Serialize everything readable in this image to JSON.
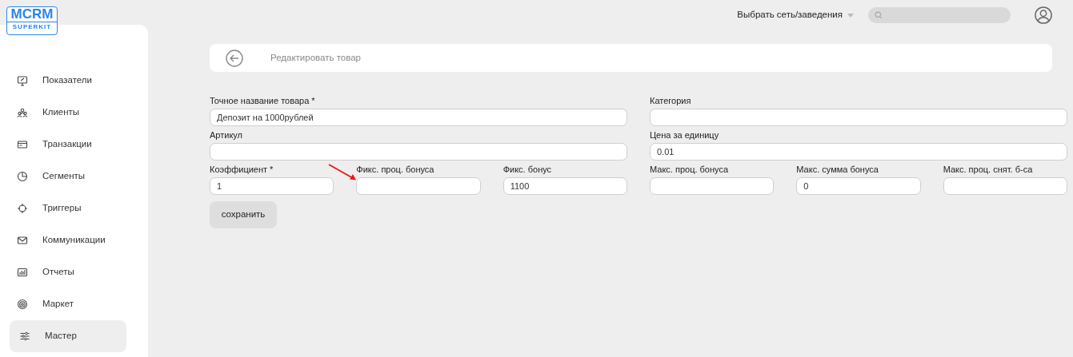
{
  "logo": {
    "title": "MCRM",
    "subtitle": "SUPERKIT"
  },
  "sidebar": {
    "items": [
      {
        "label": "Показатели",
        "selected": false
      },
      {
        "label": "Клиенты",
        "selected": false
      },
      {
        "label": "Транзакции",
        "selected": false
      },
      {
        "label": "Сегменты",
        "selected": false
      },
      {
        "label": "Триггеры",
        "selected": false
      },
      {
        "label": "Коммуникации",
        "selected": false
      },
      {
        "label": "Отчеты",
        "selected": false
      },
      {
        "label": "Маркет",
        "selected": false
      },
      {
        "label": "Мастер",
        "selected": true
      }
    ]
  },
  "topbar": {
    "network_select": "Выбрать сеть/заведения"
  },
  "header": {
    "title": "Редактировать товар"
  },
  "form": {
    "rows": [
      [
        {
          "label": "Точное название товара *",
          "value": "Депозит на 1000рублей"
        },
        {
          "label": "Категория"
        }
      ],
      [
        {
          "label": "Артикул"
        },
        {
          "label": "Цена за единицу",
          "value": "0.01"
        }
      ],
      [
        {
          "label": "Коэффициент *",
          "value": "1"
        },
        {
          "label": "Фикс. проц. бонуса"
        },
        {
          "label": "Фикс. бонус",
          "value": "1100"
        },
        {
          "label": "Макс. проц. бонуса"
        },
        {
          "label": "Макс. сумма бонуса",
          "value": "0"
        },
        {
          "label": "Макс. проц. снят. б-са"
        }
      ]
    ],
    "save_button": "сохранить"
  }
}
